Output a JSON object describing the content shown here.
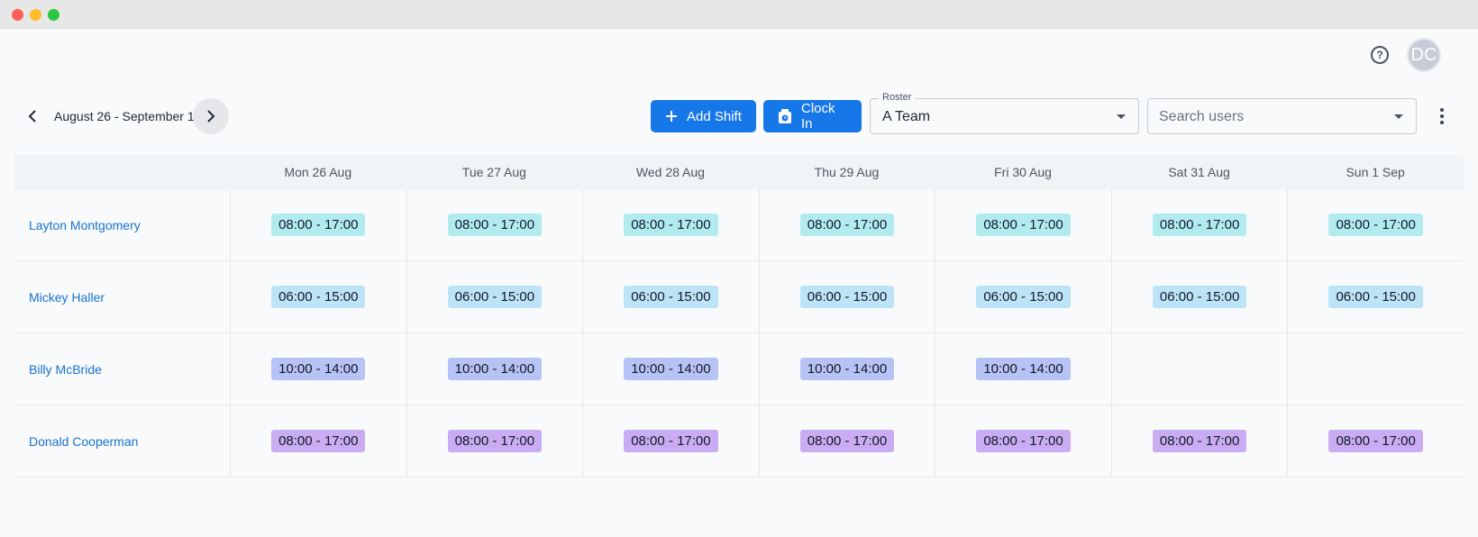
{
  "header": {
    "help_icon": "question-circle-icon",
    "avatar_initials": "DC"
  },
  "toolbar": {
    "date_range": "August 26 - September 1",
    "add_shift_label": "Add Shift",
    "clock_in_label": "Clock In",
    "roster_label": "Roster",
    "roster_value": "A Team",
    "search_placeholder": "Search users",
    "primary_color": "#1677e8"
  },
  "days": [
    "Mon 26 Aug",
    "Tue 27 Aug",
    "Wed 28 Aug",
    "Thu 29 Aug",
    "Fri 30 Aug",
    "Sat 31 Aug",
    "Sun 1 Sep"
  ],
  "rows": [
    {
      "name": "Layton Montgomery",
      "color": "#b2ebef",
      "shifts": [
        "08:00 - 17:00",
        "08:00 - 17:00",
        "08:00 - 17:00",
        "08:00 - 17:00",
        "08:00 - 17:00",
        "08:00 - 17:00",
        "08:00 - 17:00"
      ]
    },
    {
      "name": "Mickey Haller",
      "color": "#bde3f7",
      "shifts": [
        "06:00 - 15:00",
        "06:00 - 15:00",
        "06:00 - 15:00",
        "06:00 - 15:00",
        "06:00 - 15:00",
        "06:00 - 15:00",
        "06:00 - 15:00"
      ]
    },
    {
      "name": "Billy McBride",
      "color": "#b7c3f4",
      "shifts": [
        "10:00 - 14:00",
        "10:00 - 14:00",
        "10:00 - 14:00",
        "10:00 - 14:00",
        "10:00 - 14:00",
        "",
        ""
      ]
    },
    {
      "name": "Donald Cooperman",
      "color": "#c9acf1",
      "shifts": [
        "08:00 - 17:00",
        "08:00 - 17:00",
        "08:00 - 17:00",
        "08:00 - 17:00",
        "08:00 - 17:00",
        "08:00 - 17:00",
        "08:00 - 17:00"
      ]
    }
  ]
}
